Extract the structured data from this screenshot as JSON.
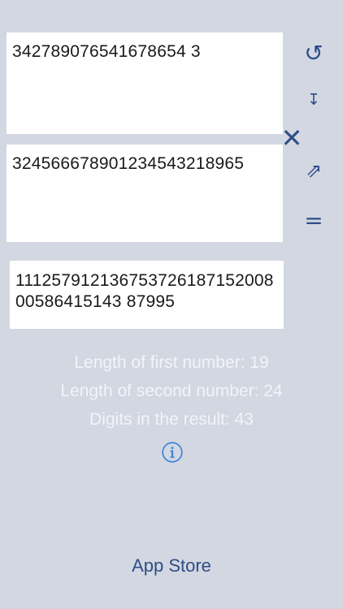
{
  "inputs": {
    "first": "342789076541678654 3",
    "second": "324566678901234543218965",
    "result": "11125791213675372618715200800586415143 87995"
  },
  "controls": {
    "reset_glyph": "↺",
    "swap_glyph": "↧",
    "multiply_glyph": "✕",
    "copy_glyph": "⇗",
    "equals_glyph": "="
  },
  "stats": {
    "first_length": "Length of first number: 19",
    "second_length": "Length of second number: 24",
    "result_digits": "Digits in the result: 43"
  },
  "footer": {
    "app_store": "App Store"
  },
  "icons": {
    "reset": "reset-icon",
    "swap": "swap-icon",
    "multiply": "multiply-icon",
    "copy": "copy-icon",
    "equals": "equals-icon",
    "info": "info-icon"
  },
  "colors": {
    "background": "#d2d7e2",
    "accent": "#2f4e86",
    "info": "#3a7fd6",
    "stat_text": "#f2f4f8"
  }
}
